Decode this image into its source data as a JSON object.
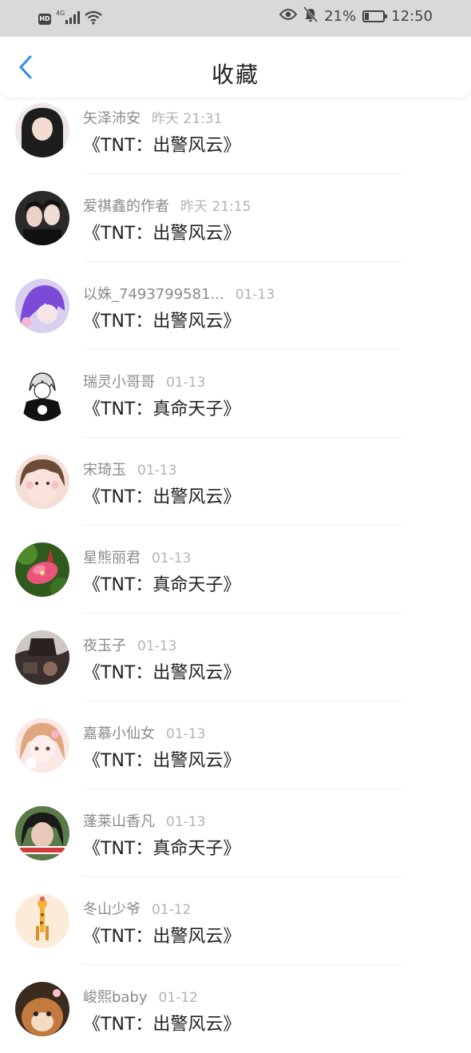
{
  "status_bar": {
    "hd": "HD",
    "network": "4G",
    "battery_pct": "21%",
    "battery_level": 0.21,
    "time": "12:50"
  },
  "header": {
    "title": "收藏"
  },
  "items": [
    {
      "user": "矢泽沛安",
      "time": "昨天 21:31",
      "title": "《TNT：出警风云》"
    },
    {
      "user": "爱祺鑫的作者",
      "time": "昨天 21:15",
      "title": "《TNT：出警风云》"
    },
    {
      "user": "以姝_7493799581...",
      "time": "01-13",
      "title": "《TNT：出警风云》"
    },
    {
      "user": "瑞灵小哥哥",
      "time": "01-13",
      "title": "《TNT：真命天子》"
    },
    {
      "user": "宋琦玉",
      "time": "01-13",
      "title": "《TNT：出警风云》"
    },
    {
      "user": "星熊丽君",
      "time": "01-13",
      "title": "《TNT：真命天子》"
    },
    {
      "user": "夜玉子",
      "time": "01-13",
      "title": "《TNT：出警风云》"
    },
    {
      "user": "嘉慕小仙女",
      "time": "01-13",
      "title": "《TNT：出警风云》"
    },
    {
      "user": "蓬莱山香凡",
      "time": "01-13",
      "title": "《TNT：真命天子》"
    },
    {
      "user": "冬山少爷",
      "time": "01-12",
      "title": "《TNT：出警风云》"
    },
    {
      "user": "峻熙baby",
      "time": "01-12",
      "title": "《TNT：出警风云》"
    }
  ],
  "colors": {
    "accent": "#2b8ef0",
    "status_bar_bg": "#d9d9d9",
    "username": "#8a8a8a",
    "timestamp": "#b3b3b3"
  }
}
